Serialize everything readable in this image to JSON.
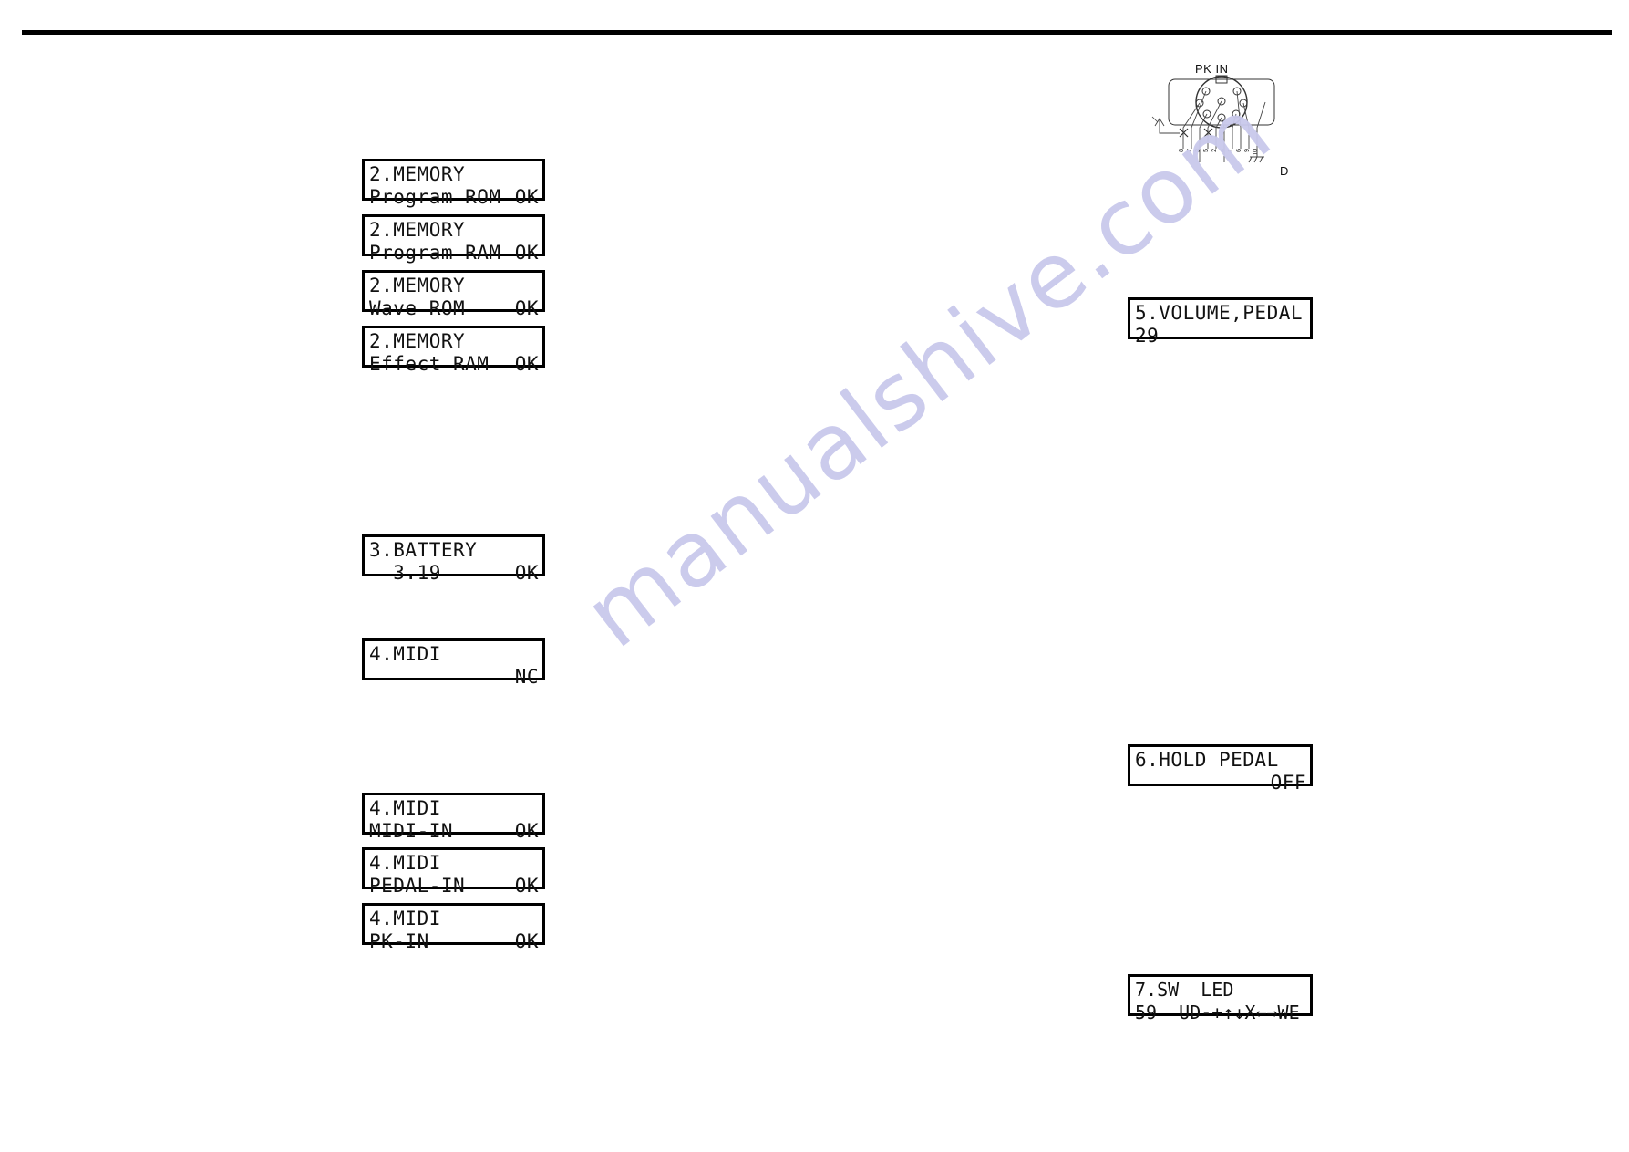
{
  "page": {
    "background_color": "#ffffff",
    "rule_color": "#000000"
  },
  "watermark": {
    "text": "manualshive.com",
    "color": "#c9c9ec"
  },
  "lcd_panels_left": [
    {
      "id": "memory-program-rom",
      "line1": "2.MEMORY",
      "line2_left": "Program ROM",
      "line2_right": "OK"
    },
    {
      "id": "memory-program-ram",
      "line1": "2.MEMORY",
      "line2_left": "Program RAM",
      "line2_right": "OK"
    },
    {
      "id": "memory-wave-rom",
      "line1": "2.MEMORY",
      "line2_left": "Wave ROM",
      "line2_right": "OK"
    },
    {
      "id": "memory-effect-ram",
      "line1": "2.MEMORY",
      "line2_left": "Effect RAM",
      "line2_right": "OK"
    },
    {
      "id": "battery",
      "line1": "3.BATTERY",
      "line2_left": "  3.19",
      "line2_right": "OK"
    },
    {
      "id": "midi-nc",
      "line1": "4.MIDI",
      "line2_left": "",
      "line2_right": "NC"
    },
    {
      "id": "midi-midi-in",
      "line1": "4.MIDI",
      "line2_left": "MIDI-IN",
      "line2_right": "OK"
    },
    {
      "id": "midi-pedal-in",
      "line1": "4.MIDI",
      "line2_left": "PEDAL-IN",
      "line2_right": "OK"
    },
    {
      "id": "midi-pk-in",
      "line1": "4.MIDI",
      "line2_left": "PK-IN",
      "line2_right": "OK"
    }
  ],
  "lcd_panels_right": [
    {
      "id": "volume-pedal",
      "line1": "5.VOLUME,PEDAL",
      "line2_left": "29",
      "line2_right": ""
    },
    {
      "id": "hold-pedal",
      "line1": "6.HOLD PEDAL",
      "line2_left": "",
      "line2_right": "OFF"
    },
    {
      "id": "sw-led",
      "line1": "7.SW  LED",
      "line2_left": "59  UD-+↑↓X←→WE",
      "line2_right": ""
    }
  ],
  "pkin_diagram": {
    "title": "PK IN",
    "ground_label": "D",
    "pin_numbers": [
      "8",
      "7",
      "3",
      "5",
      "2",
      "4",
      "1",
      "6",
      "9",
      "10"
    ],
    "crossed_pins": [
      "8",
      "2"
    ]
  }
}
